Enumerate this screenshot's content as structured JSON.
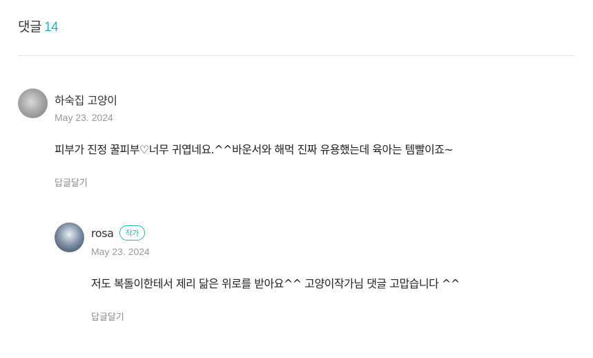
{
  "header": {
    "title": "댓글",
    "count": "14"
  },
  "comments": [
    {
      "author": "하숙집 고양이",
      "badge": "",
      "date": "May 23. 2024",
      "text": "피부가 진정 꿀피부♡너무 귀엽네요.^^바운서와 해먹 진짜 유용했는데 육아는 템빨이죠~",
      "reply_label": "답글달기"
    },
    {
      "author": "rosa",
      "badge": "작가",
      "date": "May 23. 2024",
      "text": "저도 복돌이한테서 제리 닮은 위로를 받아요^^ 고양이작가님 댓글 고맙습니다 ^^",
      "reply_label": "답글달기"
    }
  ],
  "colors": {
    "accent": "#1fb8b8",
    "muted": "#999999",
    "divider": "#e3e3e3"
  }
}
